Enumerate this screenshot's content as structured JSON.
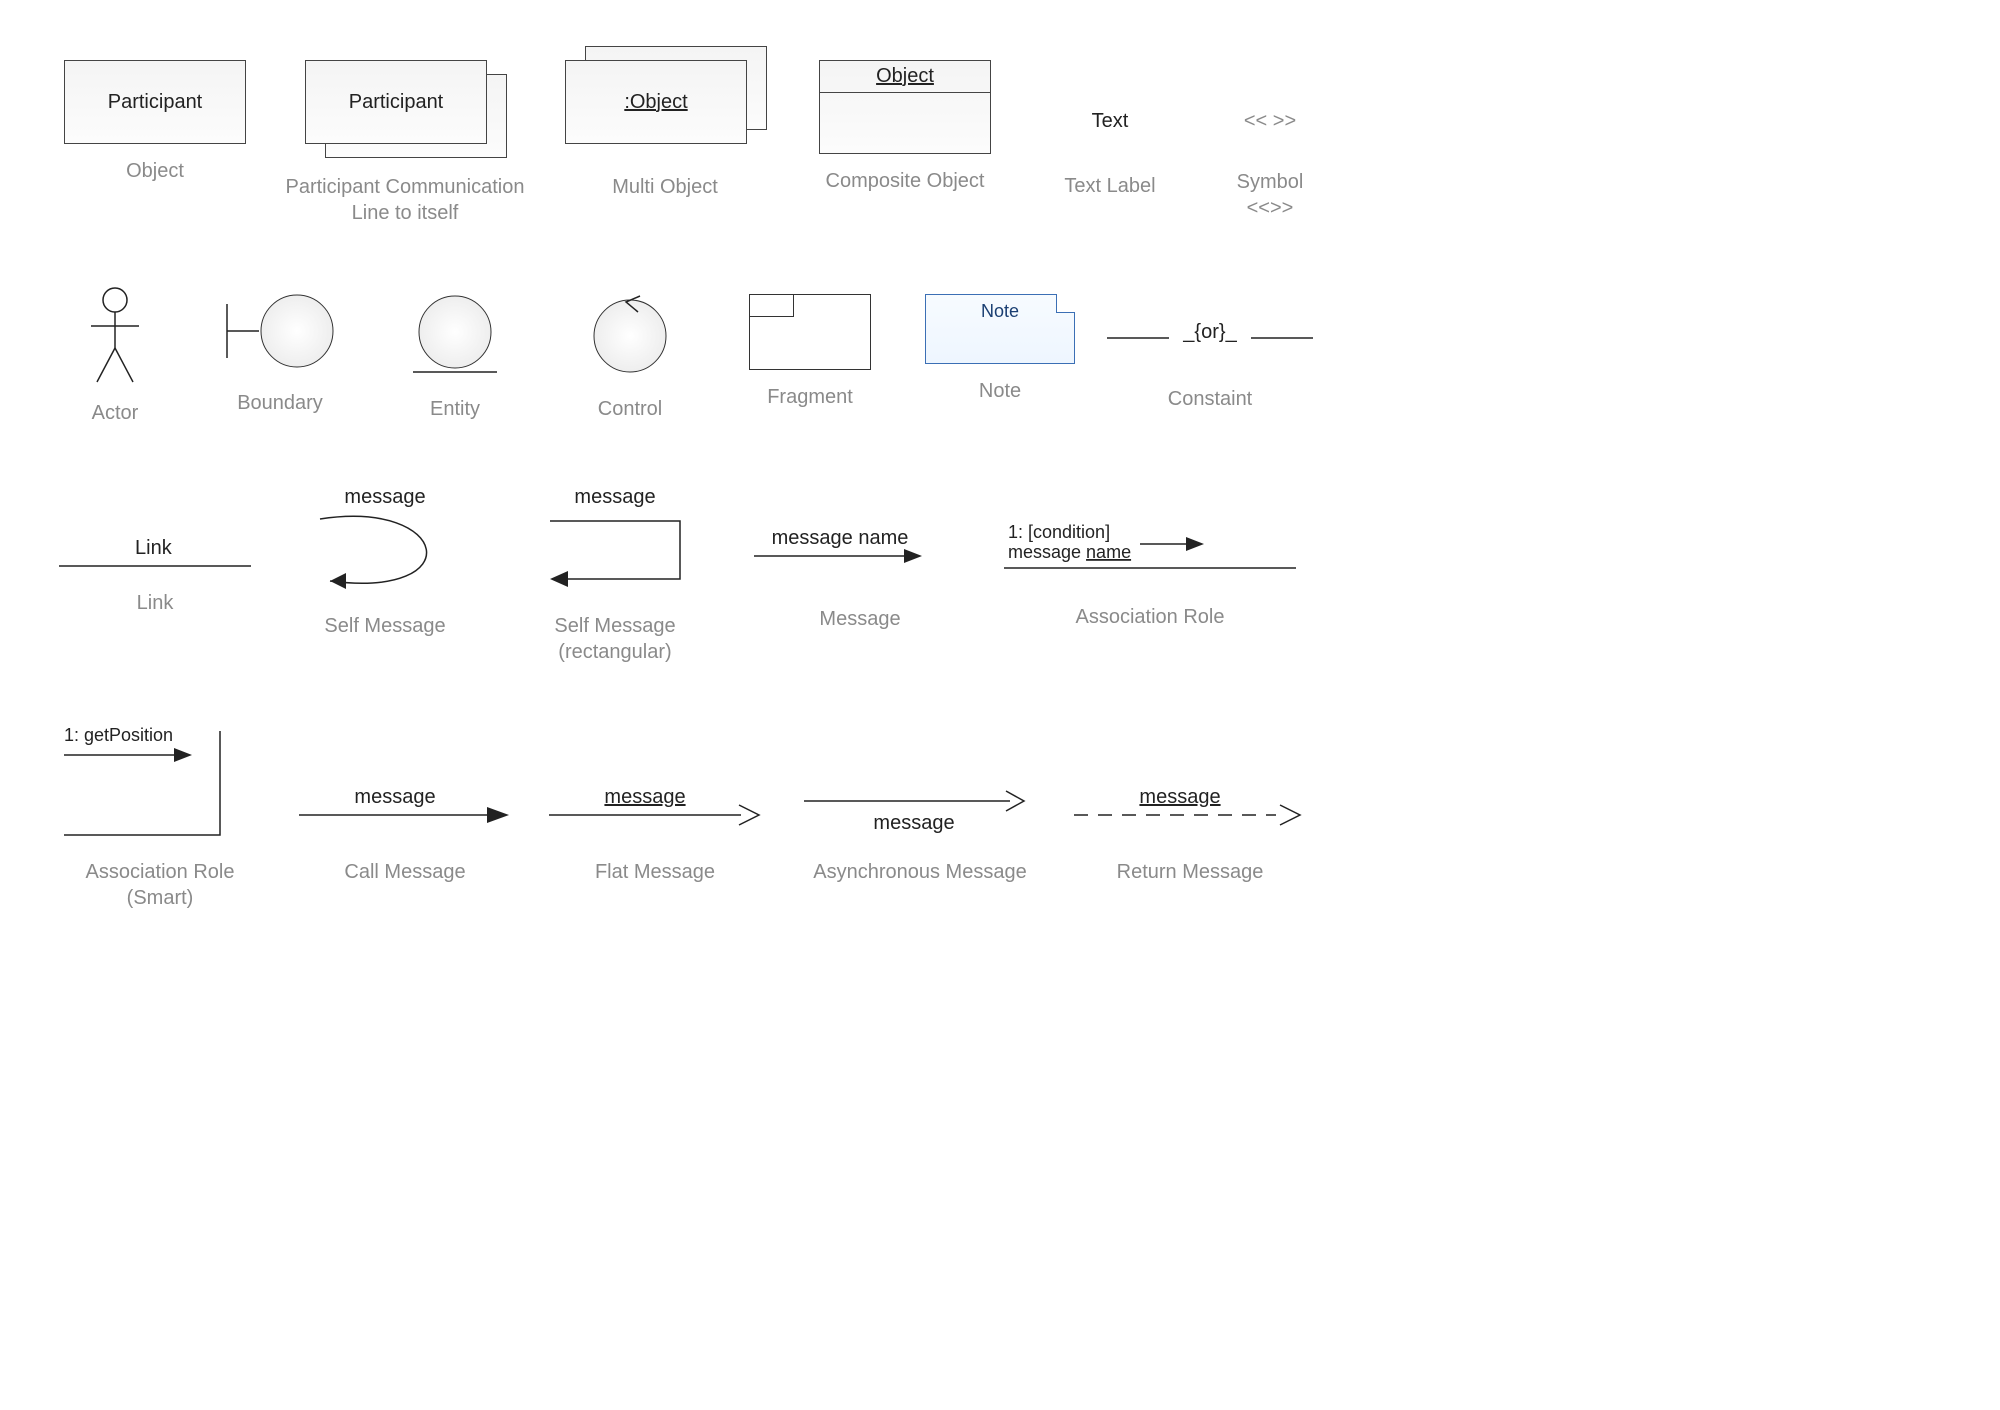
{
  "row1": {
    "object": {
      "label": "Participant",
      "caption": "Object"
    },
    "participantComm": {
      "label": "Participant",
      "caption": "Participant Communication\nLine to itself"
    },
    "multiObject": {
      "label": ":Object",
      "caption": "Multi Object"
    },
    "composite": {
      "header": "Object",
      "caption": "Composite Object"
    },
    "textLabel": {
      "text": "Text",
      "caption": "Text Label"
    },
    "symbol": {
      "text": "<< >>",
      "caption": "Symbol\n<<>>"
    }
  },
  "row2": {
    "actor": {
      "caption": "Actor"
    },
    "boundary": {
      "caption": "Boundary"
    },
    "entity": {
      "caption": "Entity"
    },
    "control": {
      "caption": "Control"
    },
    "fragment": {
      "caption": "Fragment"
    },
    "note": {
      "text": "Note",
      "caption": "Note"
    },
    "constraint": {
      "text": "_{or}_",
      "caption": "Constaint"
    }
  },
  "row3": {
    "link": {
      "text": "Link",
      "caption": "Link"
    },
    "selfMsg": {
      "text": "message",
      "caption": "Self Message"
    },
    "selfMsgRect": {
      "text": "message",
      "caption": "Self Message\n(rectangular)"
    },
    "message": {
      "text": "message name",
      "caption": "Message"
    },
    "assocRole": {
      "line1": "1: [condition]",
      "line2": "message name",
      "caption": "Association Role"
    }
  },
  "row4": {
    "assocSmart": {
      "text": "1: getPosition",
      "caption": "Association Role\n(Smart)"
    },
    "callMsg": {
      "text": "message",
      "caption": "Call Message"
    },
    "flatMsg": {
      "text": "message",
      "caption": "Flat Message"
    },
    "asyncMsg": {
      "text": "message",
      "caption": "Asynchronous Message"
    },
    "returnMsg": {
      "text": "message",
      "caption": "Return Message"
    }
  }
}
